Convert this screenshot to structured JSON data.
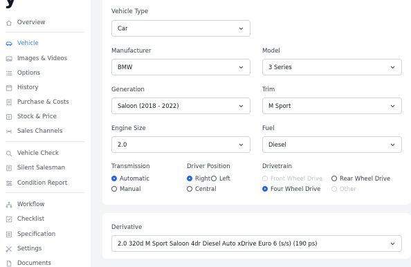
{
  "sidebar": {
    "brand_fragment": "y",
    "items": [
      {
        "label": "Overview",
        "icon": "home-icon"
      },
      {
        "label": "Vehicle",
        "icon": "car-icon",
        "active": true
      },
      {
        "label": "Images & Videos",
        "icon": "image-icon"
      },
      {
        "label": "Options",
        "icon": "list-icon"
      },
      {
        "label": "History",
        "icon": "calendar-icon"
      },
      {
        "label": "Purchase & Costs",
        "icon": "receipt-icon"
      },
      {
        "label": "Stock & Price",
        "icon": "tag-icon"
      },
      {
        "label": "Sales Channels",
        "icon": "broadcast-icon"
      },
      {
        "label": "Vehicle Check",
        "icon": "search-icon"
      },
      {
        "label": "Silent Salesman",
        "icon": "document-icon"
      },
      {
        "label": "Condition Report",
        "icon": "sliders-icon"
      },
      {
        "label": "Workflow",
        "icon": "workflow-icon"
      },
      {
        "label": "Checklist",
        "icon": "checklist-icon"
      },
      {
        "label": "Specification",
        "icon": "spec-icon"
      },
      {
        "label": "Settings",
        "icon": "settings-icon"
      },
      {
        "label": "Documents",
        "icon": "file-icon"
      }
    ],
    "accent_color": "#3b82f6"
  },
  "form": {
    "vehicle_type": {
      "label": "Vehicle Type",
      "value": "Car"
    },
    "manufacturer": {
      "label": "Manufacturer",
      "value": "BMW"
    },
    "model": {
      "label": "Model",
      "value": "3 Series"
    },
    "generation": {
      "label": "Generation",
      "value": "Saloon (2018 - 2022)"
    },
    "trim": {
      "label": "Trim",
      "value": "M Sport"
    },
    "engine_size": {
      "label": "Engine Size",
      "value": "2.0"
    },
    "fuel": {
      "label": "Fuel",
      "value": "Diesel"
    },
    "transmission": {
      "label": "Transmission",
      "options": [
        {
          "label": "Automatic",
          "checked": true
        },
        {
          "label": "Manual",
          "checked": false
        }
      ]
    },
    "driver_position": {
      "label": "Driver Position",
      "options": [
        {
          "label": "Right",
          "checked": true
        },
        {
          "label": "Left",
          "checked": false
        },
        {
          "label": "Central",
          "checked": false
        }
      ]
    },
    "drivetrain": {
      "label": "Drivetrain",
      "options": [
        {
          "label": "Front Wheel Drive",
          "checked": false,
          "disabled": true
        },
        {
          "label": "Rear Wheel Drive",
          "checked": false,
          "disabled": false
        },
        {
          "label": "Four Wheel Drive",
          "checked": true,
          "disabled": false
        },
        {
          "label": "Other",
          "checked": false,
          "disabled": true
        }
      ]
    }
  },
  "derivative": {
    "label": "Derivative",
    "value": "2.0 320d M Sport Saloon 4dr Diesel Auto xDrive Euro 6 (s/s) (190 ps)"
  }
}
